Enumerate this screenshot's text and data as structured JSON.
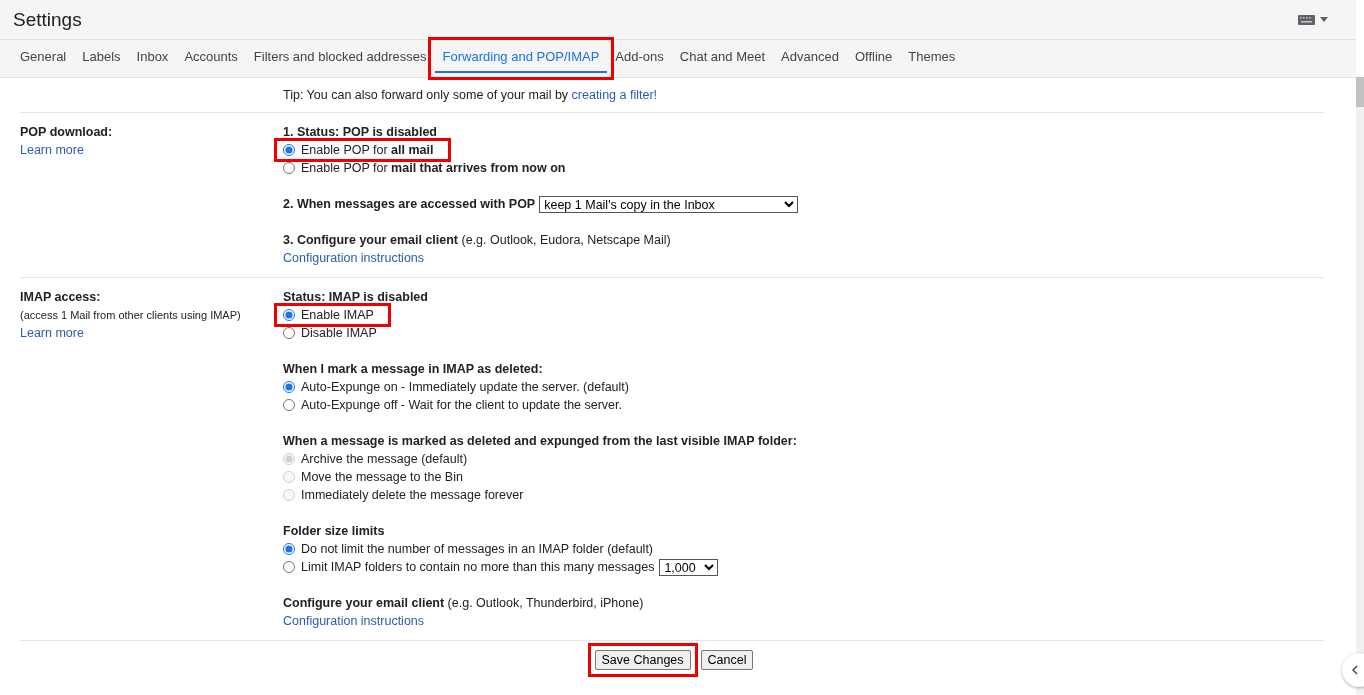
{
  "header": {
    "title": "Settings"
  },
  "tabs": [
    {
      "label": "General",
      "selected": false,
      "highlighted": false
    },
    {
      "label": "Labels",
      "selected": false,
      "highlighted": false
    },
    {
      "label": "Inbox",
      "selected": false,
      "highlighted": false
    },
    {
      "label": "Accounts",
      "selected": false,
      "highlighted": false
    },
    {
      "label": "Filters and blocked addresses",
      "selected": false,
      "highlighted": false
    },
    {
      "label": "Forwarding and POP/IMAP",
      "selected": true,
      "highlighted": true
    },
    {
      "label": "Add-ons",
      "selected": false,
      "highlighted": false
    },
    {
      "label": "Chat and Meet",
      "selected": false,
      "highlighted": false
    },
    {
      "label": "Advanced",
      "selected": false,
      "highlighted": false
    },
    {
      "label": "Offline",
      "selected": false,
      "highlighted": false
    },
    {
      "label": "Themes",
      "selected": false,
      "highlighted": false
    }
  ],
  "tip": {
    "text": "Tip: You can also forward only some of your mail by",
    "link": "creating a filter!"
  },
  "pop": {
    "label": "POP download:",
    "learn_more": "Learn more",
    "status": "1. Status: POP is disabled",
    "options": [
      {
        "label": "Enable POP for **all mail**",
        "selected": true,
        "disabled": false,
        "highlighted": true
      },
      {
        "label": "Enable POP for **mail that arrives from now on**",
        "selected": false,
        "disabled": false,
        "highlighted": false
      }
    ],
    "when_accessed": {
      "label": "2. When messages are accessed with POP",
      "value": "keep 1 Mail's copy in the Inbox"
    },
    "configure": {
      "text": "**3. Configure your email client** (e.g. Outlook, Eudora, Netscape Mail)",
      "link": "Configuration instructions"
    }
  },
  "imap": {
    "label": "IMAP access:",
    "sublabel": "(access 1 Mail from other clients using IMAP)",
    "learn_more": "Learn more",
    "groups": [
      {
        "heading": "Status: IMAP is disabled",
        "options": [
          {
            "label": "Enable IMAP",
            "selected": true,
            "disabled": false,
            "highlighted": true
          },
          {
            "label": "Disable IMAP",
            "selected": false,
            "disabled": false,
            "highlighted": false
          }
        ]
      },
      {
        "heading": "When I mark a message in IMAP as deleted:",
        "options": [
          {
            "label": "Auto-Expunge on - Immediately update the server. (default)",
            "selected": true,
            "disabled": false,
            "highlighted": false
          },
          {
            "label": "Auto-Expunge off - Wait for the client to update the server.",
            "selected": false,
            "disabled": false,
            "highlighted": false
          }
        ]
      },
      {
        "heading": "When a message is marked as deleted and expunged from the last visible IMAP folder:",
        "options": [
          {
            "label": "Archive the message (default)",
            "selected": true,
            "disabled": true,
            "highlighted": false
          },
          {
            "label": "Move the message to the Bin",
            "selected": false,
            "disabled": true,
            "highlighted": false
          },
          {
            "label": "Immediately delete the message forever",
            "selected": false,
            "disabled": true,
            "highlighted": false
          }
        ]
      },
      {
        "heading": "Folder size limits",
        "options": [
          {
            "label": "Do not limit the number of messages in an IMAP folder (default)",
            "selected": true,
            "disabled": false,
            "highlighted": false
          },
          {
            "label": "Limit IMAP folders to contain no more than this many messages",
            "selected": false,
            "disabled": false,
            "highlighted": false,
            "dropdown": "1,000"
          }
        ]
      }
    ],
    "configure": {
      "text": "**Configure your email client** (e.g. Outlook, Thunderbird, iPhone)",
      "link": "Configuration instructions"
    }
  },
  "buttons": [
    {
      "label": "Save Changes",
      "highlighted": true
    },
    {
      "label": "Cancel",
      "highlighted": false
    }
  ]
}
